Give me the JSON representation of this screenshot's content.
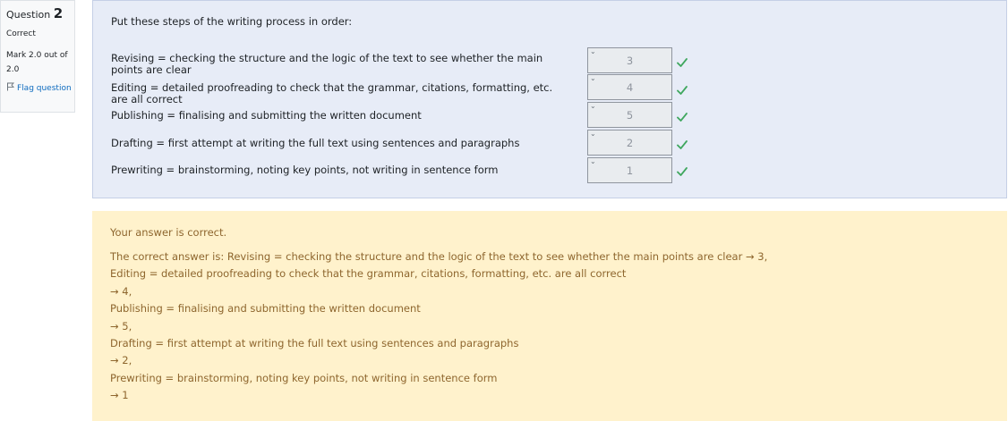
{
  "info": {
    "question_label": "Question",
    "question_number": "2",
    "state": "Correct",
    "grade": "Mark 2.0 out of 2.0",
    "flag_label": "Flag question"
  },
  "question": {
    "text": "Put these steps of the writing process in order:",
    "items": [
      {
        "text": "Revising = checking the structure and the logic of the text to see whether the main points are clear",
        "selected": "3",
        "status": "correct"
      },
      {
        "text": "Editing = detailed proofreading to check that the grammar, citations, formatting, etc. are all correct",
        "selected": "4",
        "status": "correct"
      },
      {
        "text": "Publishing = finalising and submitting the written document",
        "selected": "5",
        "status": "correct"
      },
      {
        "text": "Drafting = first attempt at writing the full text using sentences and paragraphs",
        "selected": "2",
        "status": "correct"
      },
      {
        "text": "Prewriting = brainstorming, noting key points, not writing in sentence form",
        "selected": "1",
        "status": "correct"
      }
    ]
  },
  "outcome": {
    "feedback": "Your answer is correct.",
    "right_answer_lines": [
      "The correct answer is: Revising = checking the structure and the logic of the text to see whether the main points are clear → 3,",
      "Editing = detailed proofreading to check that the grammar, citations, formatting, etc. are all correct",
      "→ 4,",
      "Publishing = finalising and submitting the written document",
      "→ 5,",
      "Drafting = first attempt at writing the full text using sentences and paragraphs",
      "→ 2,",
      "Prewriting = brainstorming, noting key points, not writing in sentence form",
      "→ 1"
    ]
  },
  "colors": {
    "formulation_bg": "#e7ecf7",
    "outcome_bg": "#fff2cc",
    "outcome_text": "#8e662e",
    "correct_tick": "#3fa75e",
    "link": "#0f6cbf"
  },
  "icons": {
    "flag": "flag-icon",
    "tick": "check-icon",
    "select_arrow": "chevron-down-icon"
  }
}
